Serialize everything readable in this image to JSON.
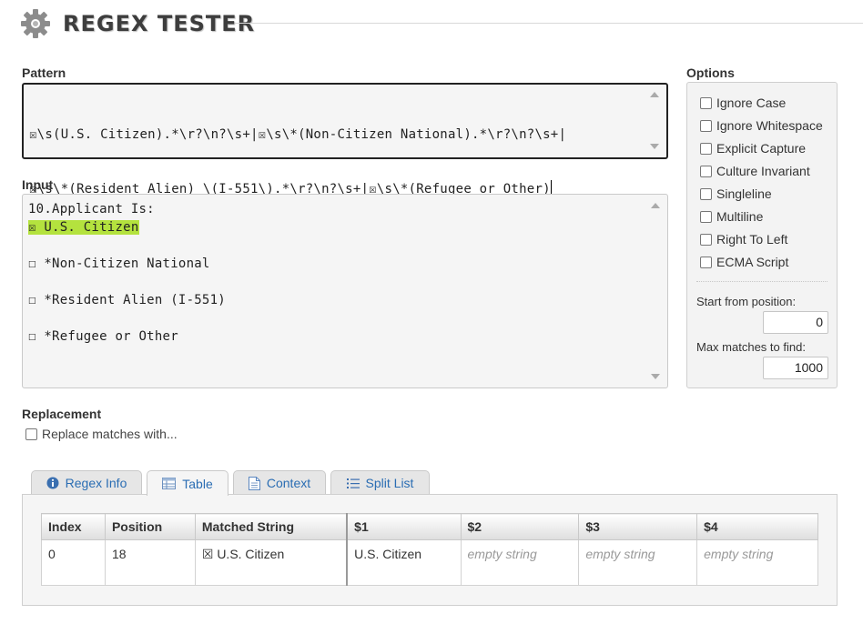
{
  "app": {
    "title": "REGEX TESTER"
  },
  "pattern": {
    "label": "Pattern",
    "lines": [
      "☒\\s(U.S. Citizen).*\\r?\\n?\\s+|☒\\s\\*(Non-Citizen National).*\\r?\\n?\\s+|",
      "☒\\s\\*(Resident Alien) \\(I-551\\).*\\r?\\n?\\s+|☒\\s\\*(Refugee or Other)"
    ]
  },
  "input": {
    "label": "Input",
    "lines": [
      {
        "text": "10.Applicant Is:",
        "highlight": false
      },
      {
        "text": "☒ U.S. Citizen",
        "highlight": true
      },
      {
        "text": "",
        "highlight": false
      },
      {
        "text": "☐ *Non-Citizen National",
        "highlight": false
      },
      {
        "text": "",
        "highlight": false
      },
      {
        "text": "☐ *Resident Alien (I-551)",
        "highlight": false
      },
      {
        "text": "",
        "highlight": false
      },
      {
        "text": "☐ *Refugee or Other",
        "highlight": false
      }
    ],
    "highlight_color": "#b4e23e"
  },
  "options": {
    "label": "Options",
    "checkboxes": [
      {
        "label": "Ignore Case",
        "checked": false
      },
      {
        "label": "Ignore Whitespace",
        "checked": false
      },
      {
        "label": "Explicit Capture",
        "checked": false
      },
      {
        "label": "Culture Invariant",
        "checked": false
      },
      {
        "label": "Singleline",
        "checked": false
      },
      {
        "label": "Multiline",
        "checked": false
      },
      {
        "label": "Right To Left",
        "checked": false
      },
      {
        "label": "ECMA Script",
        "checked": false
      }
    ],
    "start_label": "Start from position:",
    "start_value": "0",
    "max_label": "Max matches to find:",
    "max_value": "1000"
  },
  "replacement": {
    "label": "Replacement",
    "checkbox_label": "Replace matches with...",
    "checked": false
  },
  "tabs": [
    {
      "label": "Regex Info",
      "icon": "info-icon",
      "active": false
    },
    {
      "label": "Table",
      "icon": "table-icon",
      "active": true
    },
    {
      "label": "Context",
      "icon": "document-icon",
      "active": false
    },
    {
      "label": "Split List",
      "icon": "list-icon",
      "active": false
    }
  ],
  "results": {
    "columns": [
      "Index",
      "Position",
      "Matched String",
      "$1",
      "$2",
      "$3",
      "$4"
    ],
    "rows": [
      [
        "0",
        "18",
        "☒ U.S. Citizen",
        "U.S. Citizen",
        "empty string",
        "empty string",
        "empty string"
      ]
    ]
  },
  "colors": {
    "accent": "#2a6db3",
    "title": "#3d3d3d"
  }
}
